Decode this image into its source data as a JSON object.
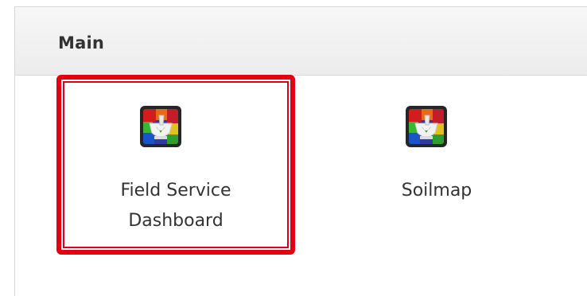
{
  "panel": {
    "title": "Main"
  },
  "tiles": [
    {
      "icon": "mortar-pestle-icon",
      "label_line1": "Field Service",
      "label_line2": "Dashboard",
      "highlighted": true
    },
    {
      "icon": "mortar-pestle-icon",
      "label_line1": "Soilmap",
      "label_line2": "",
      "highlighted": false
    }
  ],
  "colors": {
    "highlight": "#e3000f",
    "header_bg": "#f0f0f0",
    "text": "#333333",
    "icon_bg": "#262626"
  }
}
